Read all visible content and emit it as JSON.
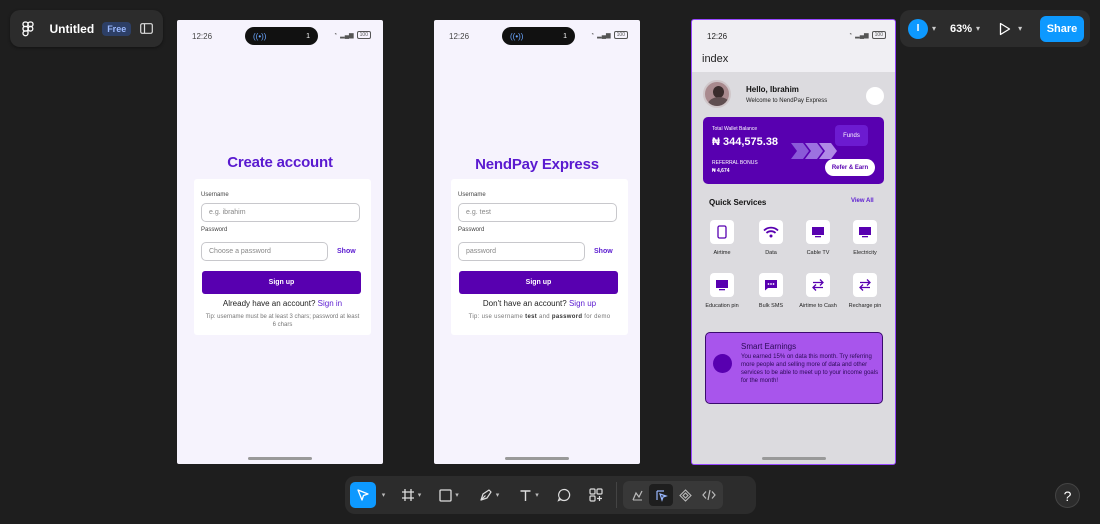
{
  "app": {
    "file_name": "Untitled",
    "plan_badge": "Free"
  },
  "header_right": {
    "user_initial": "I",
    "zoom": "63%",
    "share_label": "Share"
  },
  "status": {
    "time": "12:26",
    "island_count": "1",
    "battery": "100"
  },
  "screen1": {
    "title": "Create account",
    "username_label": "Username",
    "username_placeholder": "e.g. ibrahim",
    "password_label": "Password",
    "password_placeholder": "Choose a password",
    "show_label": "Show",
    "signup_label": "Sign up",
    "alt_prefix": "Already have an account?",
    "alt_link": "Sign in",
    "tip": "Tip: username must be at least 3 chars; password at least 6 chars"
  },
  "screen2": {
    "title": "NendPay Express",
    "username_label": "Username",
    "username_placeholder": "e.g. test",
    "password_label": "Password",
    "password_placeholder": "password",
    "show_label": "Show",
    "signup_label": "Sign up",
    "alt_prefix": "Don't have an account?",
    "alt_link": "Sign up",
    "tip_prefix": "Tip: use username",
    "tip_user": "test",
    "tip_mid": "and",
    "tip_pass": "password",
    "tip_suffix": "for demo"
  },
  "screen3": {
    "route": "index",
    "greeting": "Hello, Ibrahim",
    "welcome": "Welcome to NendPay Express",
    "wallet_label": "Total Wallet Balance",
    "wallet_balance": "₦ 344,575.38",
    "funds_label": "Funds",
    "referral_label": "REFERRAL BONUS",
    "referral_value": "₦ 4,674",
    "refer_label": "Refer & Earn",
    "quick_services_title": "Quick Services",
    "view_all": "View All",
    "services": [
      {
        "label": "Airtime",
        "icon": "phone-icon"
      },
      {
        "label": "Data",
        "icon": "wifi-icon"
      },
      {
        "label": "Cable TV",
        "icon": "tv-icon"
      },
      {
        "label": "Electricity",
        "icon": "tv-icon"
      },
      {
        "label": "Education pin",
        "icon": "tv-icon"
      },
      {
        "label": "Bulk SMS",
        "icon": "chat-icon"
      },
      {
        "label": "Airtime to Cash",
        "icon": "swap-icon"
      },
      {
        "label": "Recharge pin",
        "icon": "swap-icon"
      }
    ],
    "smart_title": "Smart Earnings",
    "smart_text": "You earned 15% on data this month. Try referring more people and selling more of data and other services to be able to meet up to your income goals for the month!"
  },
  "colors": {
    "accent": "#0d99ff",
    "brand_purple": "#5800b0",
    "selection": "#9747ff"
  }
}
